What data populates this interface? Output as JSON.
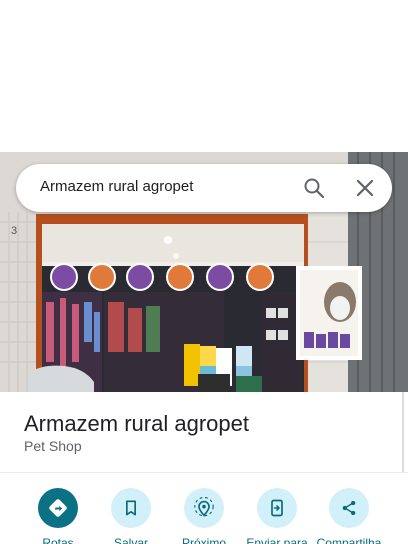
{
  "search": {
    "query": "Armazem rural agropet",
    "search_icon": "search-icon",
    "close_icon": "close-icon"
  },
  "photo": {
    "street_number": "3",
    "description_icon": "store-photo"
  },
  "place": {
    "name": "Armazem rural agropet",
    "category": "Pet Shop"
  },
  "actions": [
    {
      "label": "Rotas",
      "icon": "directions-icon"
    },
    {
      "label": "Salvar",
      "icon": "bookmark-icon"
    },
    {
      "label": "Próximo",
      "icon": "nearby-icon"
    },
    {
      "label": "Enviar para",
      "icon": "send-to-phone-icon"
    },
    {
      "label": "Compartilha",
      "icon": "share-icon"
    }
  ],
  "colors": {
    "primary": "#0b7285",
    "chip": "#d2f0fa",
    "label": "#0b6a78",
    "title": "#202124",
    "secondary": "#5f6368"
  }
}
